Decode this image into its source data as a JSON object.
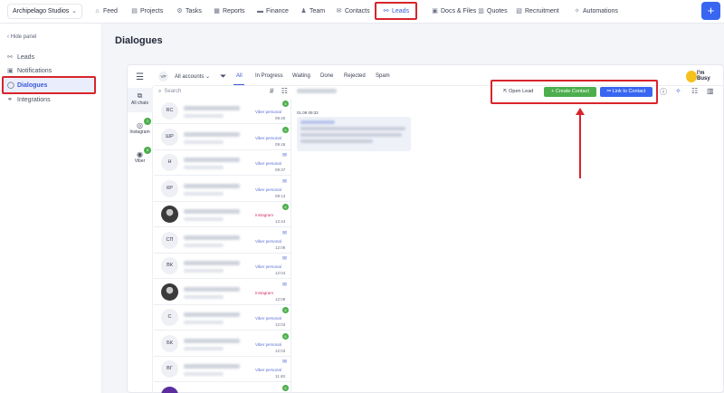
{
  "topbar": {
    "company": "Archipelago Studios",
    "nav": [
      {
        "label": "Feed",
        "icon": "feed-icon",
        "glyph": "⌂"
      },
      {
        "label": "Projects",
        "icon": "projects-icon",
        "glyph": "▤"
      },
      {
        "label": "Tasks",
        "icon": "tasks-icon",
        "glyph": "⚙"
      },
      {
        "label": "Reports",
        "icon": "reports-icon",
        "glyph": "▦"
      },
      {
        "label": "Finance",
        "icon": "finance-icon",
        "glyph": "▬"
      },
      {
        "label": "Team",
        "icon": "team-icon",
        "glyph": "♟"
      },
      {
        "label": "Contacts",
        "icon": "contacts-icon",
        "glyph": "✉"
      },
      {
        "label": "Leads",
        "icon": "leads-icon",
        "glyph": "⚯"
      },
      {
        "label": "Docs & Files",
        "icon": "docs-icon",
        "glyph": "▣"
      },
      {
        "label": "Quotes",
        "icon": "quotes-icon",
        "glyph": "▥"
      },
      {
        "label": "Recruitment",
        "icon": "recruitment-icon",
        "glyph": "▧"
      },
      {
        "label": "Automations",
        "icon": "automations-icon",
        "glyph": "✧"
      }
    ],
    "active_nav": "Leads",
    "plus": "+"
  },
  "leftpanel": {
    "hide_panel": "Hide panel",
    "items": [
      {
        "label": "Leads",
        "icon": "leads-icon"
      },
      {
        "label": "Notifications",
        "icon": "notifications-icon"
      },
      {
        "label": "Dialogues",
        "icon": "dialogues-icon"
      },
      {
        "label": "Integrations",
        "icon": "integrations-icon"
      }
    ],
    "active": "Dialogues"
  },
  "page": {
    "title": "Dialogues"
  },
  "channels": [
    {
      "label": "All chats",
      "icon": "chat-icon"
    },
    {
      "label": "Instagram",
      "icon": "instagram-icon",
      "badge": "1"
    },
    {
      "label": "Viber",
      "icon": "viber-icon",
      "badge": "5"
    }
  ],
  "filters": {
    "vp": "VP",
    "accounts": "All accounts",
    "tabs": [
      "All",
      "In Progress",
      "Waiting",
      "Done",
      "Rejected",
      "Spam"
    ],
    "active_tab": "All"
  },
  "search": {
    "placeholder": "Search"
  },
  "chats": [
    {
      "initials": "RC",
      "source": "Viber personal",
      "time": "09:40",
      "badge": "6"
    },
    {
      "initials": "ШР",
      "source": "Viber personal",
      "time": "09:46",
      "badge": "6"
    },
    {
      "initials": "Н",
      "source": "Viber personal",
      "time": "09:37",
      "mail": true
    },
    {
      "initials": "КР",
      "source": "Viber personal",
      "time": "09:13",
      "mail": true
    },
    {
      "initials": "",
      "source": "Instagram",
      "time": "12:44",
      "badge": "6",
      "photo": true
    },
    {
      "initials": "СП",
      "source": "Viber personal",
      "time": "12:09",
      "mail": true
    },
    {
      "initials": "ВК",
      "source": "Viber personal",
      "time": "12:04",
      "mail": true
    },
    {
      "initials": "",
      "source": "Instagram",
      "time": "12:09",
      "mail": true,
      "photo": true
    },
    {
      "initials": "С",
      "source": "Viber personal",
      "time": "12:03",
      "badge": "6"
    },
    {
      "initials": "БК",
      "source": "Viber personal",
      "time": "12:03",
      "badge": "6"
    },
    {
      "initials": "ВГ",
      "source": "Viber personal",
      "time": "11:48",
      "mail": true
    },
    {
      "initials": "",
      "source": "",
      "time": "",
      "badge": "6",
      "purple": true
    }
  ],
  "conversation": {
    "date": "01.09 09:32"
  },
  "actions": {
    "open_lead": "Open Lead",
    "create_contact": "Create Contact",
    "link_contact": "Link to Contact"
  },
  "busy": {
    "line1": "I'm",
    "line2": "Busy"
  }
}
